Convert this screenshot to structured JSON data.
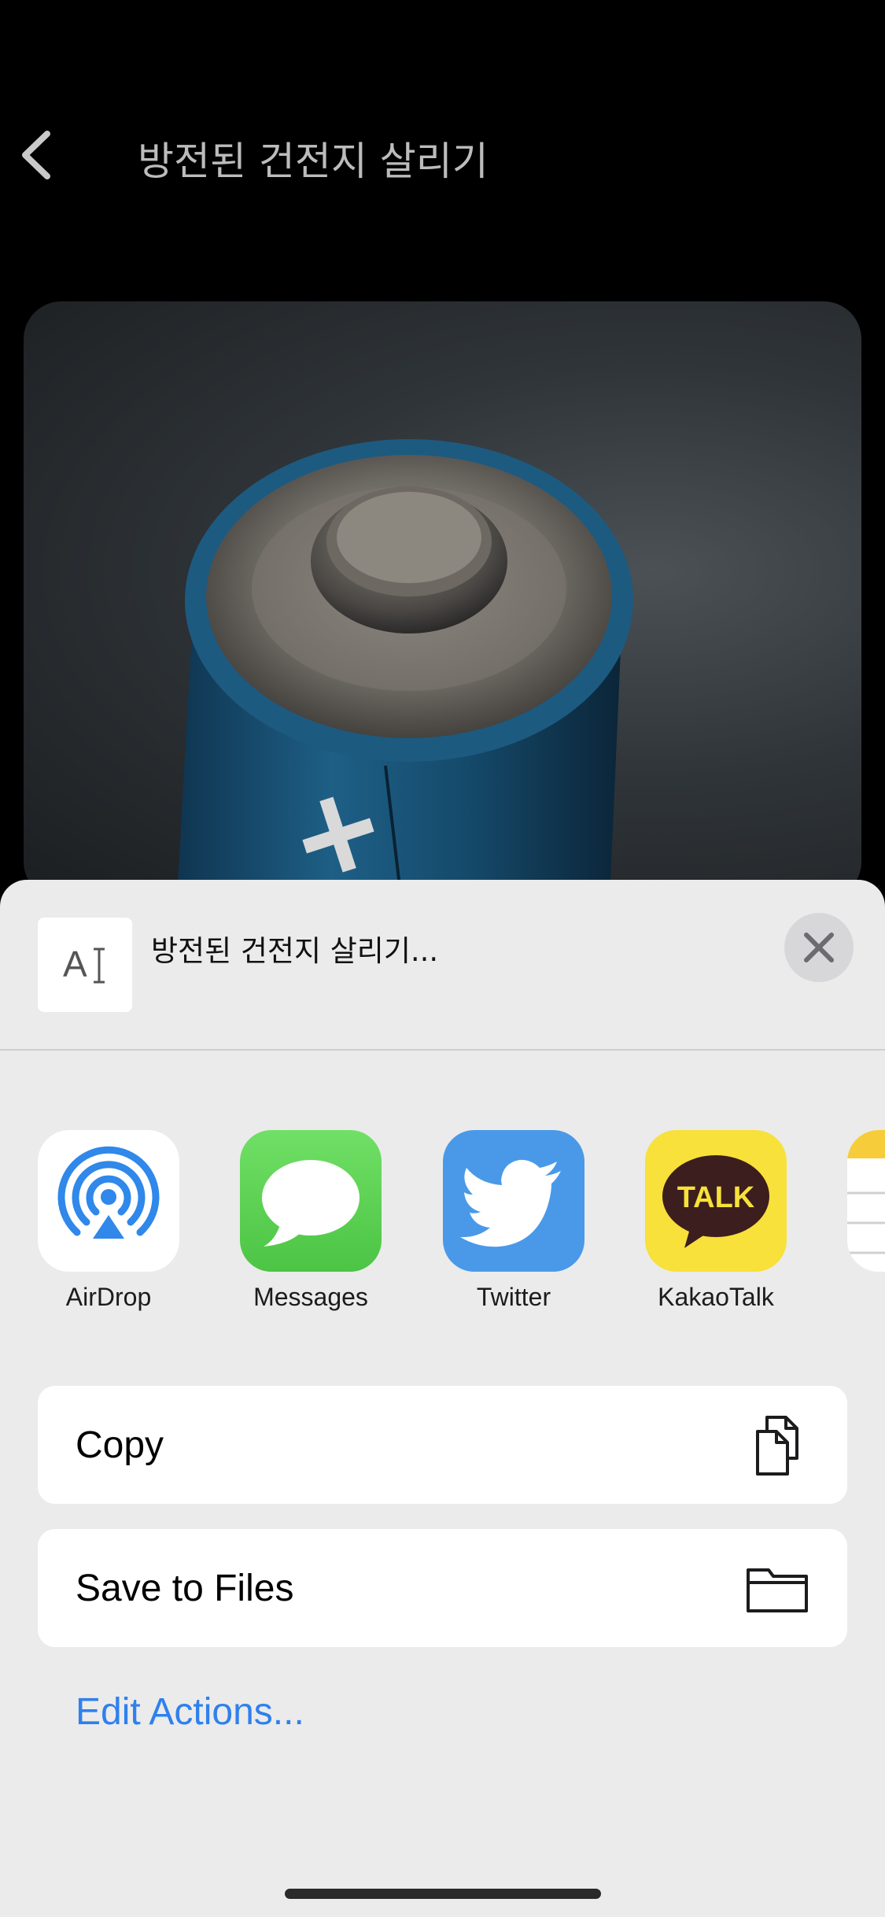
{
  "nav": {
    "title": "방전된 건전지 살리기"
  },
  "share_sheet": {
    "preview_title": "방전된 건전지 살리기...",
    "preview_thumb_text": "A",
    "apps": [
      {
        "label": "AirDrop",
        "icon": "airdrop-icon"
      },
      {
        "label": "Messages",
        "icon": "messages-icon"
      },
      {
        "label": "Twitter",
        "icon": "twitter-icon"
      },
      {
        "label": "KakaoTalk",
        "icon": "kakaotalk-icon",
        "icon_text": "TALK"
      },
      {
        "label": "",
        "icon": "notes-icon"
      }
    ],
    "actions": [
      {
        "label": "Copy",
        "icon": "copy-icon"
      },
      {
        "label": "Save to Files",
        "icon": "folder-icon"
      }
    ],
    "edit_actions": "Edit Actions..."
  },
  "colors": {
    "sheet_bg": "#ebebeb",
    "link_blue": "#2f80ed",
    "messages_green": "#5fd55a",
    "twitter_blue": "#4a99e9",
    "kakao_yellow": "#f7e13a"
  }
}
